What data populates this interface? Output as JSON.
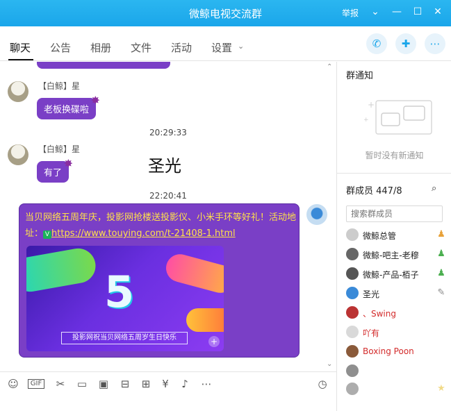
{
  "window": {
    "title": "微鲸电视交流群",
    "report": "举报"
  },
  "tabs": [
    {
      "label": "聊天"
    },
    {
      "label": "公告"
    },
    {
      "label": "相册"
    },
    {
      "label": "文件"
    },
    {
      "label": "活动"
    },
    {
      "label": "设置"
    }
  ],
  "chat": {
    "messages": [
      {
        "sender": "【白鲸】星",
        "text": "老板换碟啦"
      },
      {
        "time": "20:29:33"
      },
      {
        "sender": "【白鲸】星",
        "text": "有了"
      },
      {
        "note": "圣光"
      },
      {
        "time": "22:20:41"
      },
      {
        "text_part1": "当贝网络五周年庆，投影网抢楼送投影仪、小米手环等好礼！活动地址：",
        "link": "https://www.touying.com/t-21408-1.html",
        "banner_caption": "投影网祝当贝网络五周岁生日快乐",
        "banner_number": "5"
      }
    ]
  },
  "notice": {
    "title": "群通知",
    "empty_text": "暂时没有新通知"
  },
  "members": {
    "title": "群成员 447/8",
    "search_placeholder": "搜索群成员",
    "list": [
      {
        "name": "微鲸总管",
        "color": "#222222"
      },
      {
        "name": "微鲸-吧主-老穆",
        "color": "#222222"
      },
      {
        "name": "微鲸-产品-栢子",
        "color": "#222222"
      },
      {
        "name": "圣光",
        "color": "#222222"
      },
      {
        "name": "、Swing",
        "color": "#d32b2b"
      },
      {
        "name": "吖有",
        "color": "#d32b2b"
      },
      {
        "name": "Boxing Poon",
        "color": "#d32b2b"
      }
    ]
  }
}
